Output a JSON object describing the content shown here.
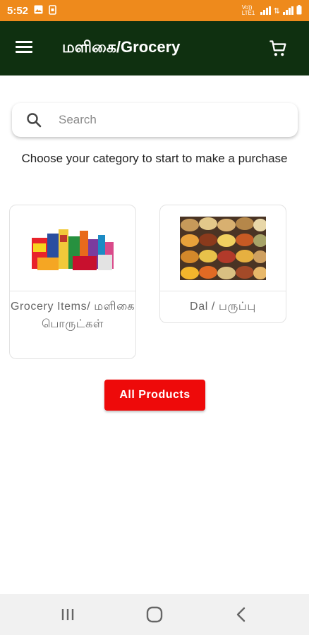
{
  "status_bar": {
    "time": "5:52",
    "network": "Vo)) LTE1",
    "colors": {
      "background": "#ee8a1c"
    }
  },
  "app_bar": {
    "title": "மளிகை/Grocery",
    "menu_icon": "hamburger-menu-icon",
    "cart_icon": "shopping-cart-icon",
    "colors": {
      "background": "#0f3010",
      "foreground": "#ffffff"
    }
  },
  "search": {
    "placeholder": "Search",
    "value": "",
    "icon": "search-icon"
  },
  "intro_text": "Choose your category to start to make a purchase",
  "categories": [
    {
      "label": "Grocery Items/ மளிகை பொருட்கள்",
      "image": "grocery-products-image"
    },
    {
      "label": "Dal / பருப்பு",
      "image": "dal-lentils-image"
    }
  ],
  "all_products_button": {
    "label": "All Products",
    "color": "#ee0a0a"
  },
  "nav_bar": {
    "icons": [
      "recent-apps-icon",
      "home-icon",
      "back-icon"
    ]
  }
}
